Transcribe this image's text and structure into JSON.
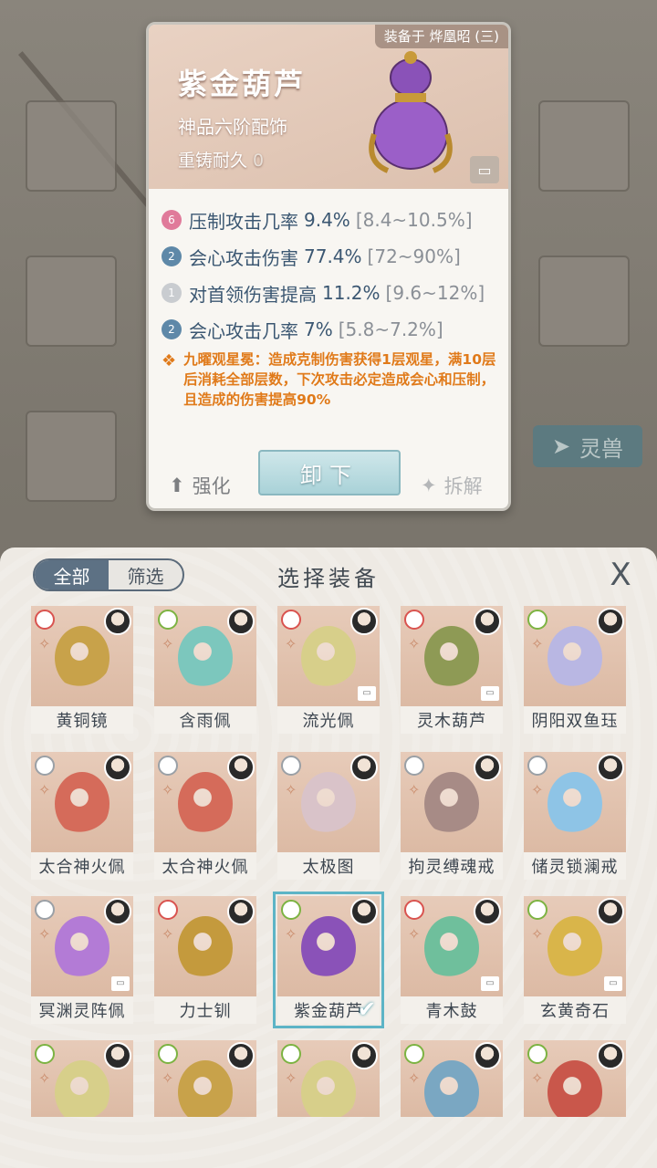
{
  "detail": {
    "equipped_on": "装备于 烨凰昭 (三)",
    "name": "紫金葫芦",
    "rank": "神品六阶配饰",
    "reforge_label": "重铸耐久",
    "reforge_value": "0",
    "stats": [
      {
        "badge": "6",
        "badge_color": "#e07a9a",
        "label": "压制攻击几率",
        "value": "9.4%",
        "range": "[8.4~10.5%]"
      },
      {
        "badge": "2",
        "badge_color": "#5e88a8",
        "label": "会心攻击伤害",
        "value": "77.4%",
        "range": "[72~90%]"
      },
      {
        "badge": "1",
        "badge_color": "#c9ccd0",
        "label": "对首领伤害提高",
        "value": "11.2%",
        "range": "[9.6~12%]"
      },
      {
        "badge": "2",
        "badge_color": "#5e88a8",
        "label": "会心攻击几率",
        "value": "7%",
        "range": "[5.8~7.2%]"
      }
    ],
    "skill_text": "九曜观星冕：造成克制伤害获得1层观星，满10层后消耗全部层数，下次攻击必定造成会心和压制，且造成的伤害提高90%",
    "unequip_label": "卸下",
    "upgrade_label": "强化",
    "dismantle_label": "拆解"
  },
  "background": {
    "tab_label": "灵兽"
  },
  "panel": {
    "filter_all": "全部",
    "filter_screen": "筛选",
    "title": "选择装备",
    "close_symbol": "X"
  },
  "items": [
    {
      "name": "黄铜镜",
      "color": "#c8a24a",
      "elem": "r"
    },
    {
      "name": "含雨佩",
      "color": "#7cc7bd",
      "elem": "g"
    },
    {
      "name": "流光佩",
      "color": "#d7cf8a",
      "elem": "r"
    },
    {
      "name": "灵木葫芦",
      "color": "#8e9a55",
      "elem": "r"
    },
    {
      "name": "阴阳双鱼珏",
      "color": "#b9b7e3",
      "elem": "g"
    },
    {
      "name": "太合神火佩",
      "color": "#d56b5a",
      "elem": "gr"
    },
    {
      "name": "太合神火佩",
      "color": "#d56b5a",
      "elem": "gr"
    },
    {
      "name": "太极图",
      "color": "#d9c3c9",
      "elem": "gr"
    },
    {
      "name": "拘灵缚魂戒",
      "color": "#a78b86",
      "elem": "gr"
    },
    {
      "name": "储灵锁澜戒",
      "color": "#8ec4e6",
      "elem": "gr"
    },
    {
      "name": "冥渊灵阵佩",
      "color": "#b37bd6",
      "elem": "gr"
    },
    {
      "name": "力士钏",
      "color": "#c49a3d",
      "elem": "r"
    },
    {
      "name": "紫金葫芦",
      "color": "#8a52b8",
      "elem": "g"
    },
    {
      "name": "青木鼓",
      "color": "#6fbf9c",
      "elem": "r"
    },
    {
      "name": "玄黄奇石",
      "color": "#d9b54a",
      "elem": "g"
    },
    {
      "name": "",
      "color": "#d7cf8a",
      "elem": "g"
    },
    {
      "name": "",
      "color": "#c8a24a",
      "elem": "g"
    },
    {
      "name": "",
      "color": "#d7cf8a",
      "elem": "g"
    },
    {
      "name": "",
      "color": "#7aa7c2",
      "elem": "g"
    },
    {
      "name": "",
      "color": "#c9574b",
      "elem": "g"
    }
  ]
}
